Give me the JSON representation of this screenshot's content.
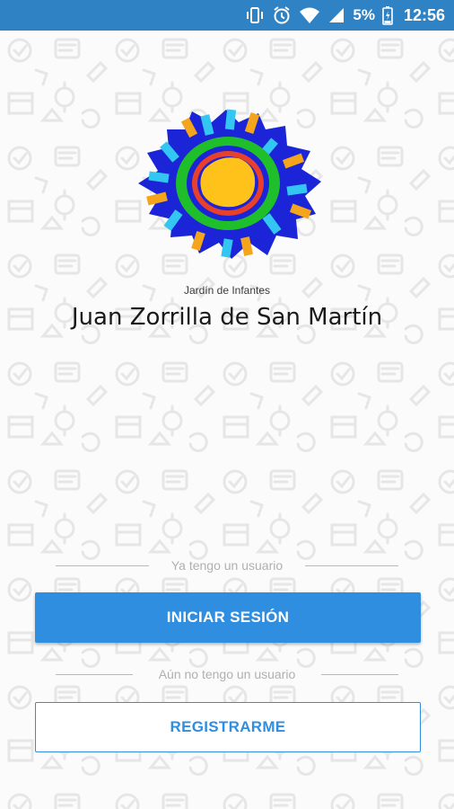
{
  "status_bar": {
    "battery_percent": "5%",
    "time": "12:56",
    "icons": [
      "vibrate-icon",
      "alarm-icon",
      "wifi-icon",
      "signal-icon",
      "battery-charging-icon"
    ]
  },
  "header": {
    "subtitle": "Jardín de Infantes",
    "title": "Juan Zorrilla de San Martín"
  },
  "login_section": {
    "divider_label": "Ya tengo un usuario",
    "button_label": "INICIAR SESIÓN"
  },
  "register_section": {
    "divider_label": "Aún no tengo un usuario",
    "button_label": "REGISTRARME"
  },
  "colors": {
    "status_bar": "#2f83c4",
    "primary": "#2f8ee0",
    "background": "#fbfbfb"
  }
}
